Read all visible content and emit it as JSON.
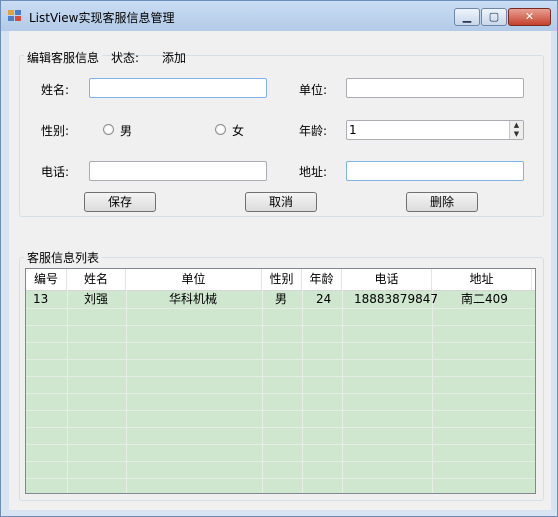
{
  "window": {
    "title": "ListView实现客服信息管理"
  },
  "form": {
    "legend_group": "编辑客服信息",
    "status_label": "状态:",
    "status_value": "添加",
    "name_label": "姓名:",
    "name_value": "",
    "unit_label": "单位:",
    "unit_value": "",
    "gender_label": "性别:",
    "male_label": "男",
    "female_label": "女",
    "age_label": "年龄:",
    "age_value": "1",
    "phone_label": "电话:",
    "phone_value": "",
    "address_label": "地址:",
    "address_value": "",
    "save_label": "保存",
    "cancel_label": "取消",
    "delete_label": "删除"
  },
  "list": {
    "legend": "客服信息列表",
    "columns": [
      "编号",
      "姓名",
      "单位",
      "性别",
      "年龄",
      "电话",
      "地址"
    ],
    "rows": [
      [
        "13",
        "刘强",
        "华科机械",
        "男",
        "24",
        "18883879847",
        "南二409"
      ]
    ]
  }
}
